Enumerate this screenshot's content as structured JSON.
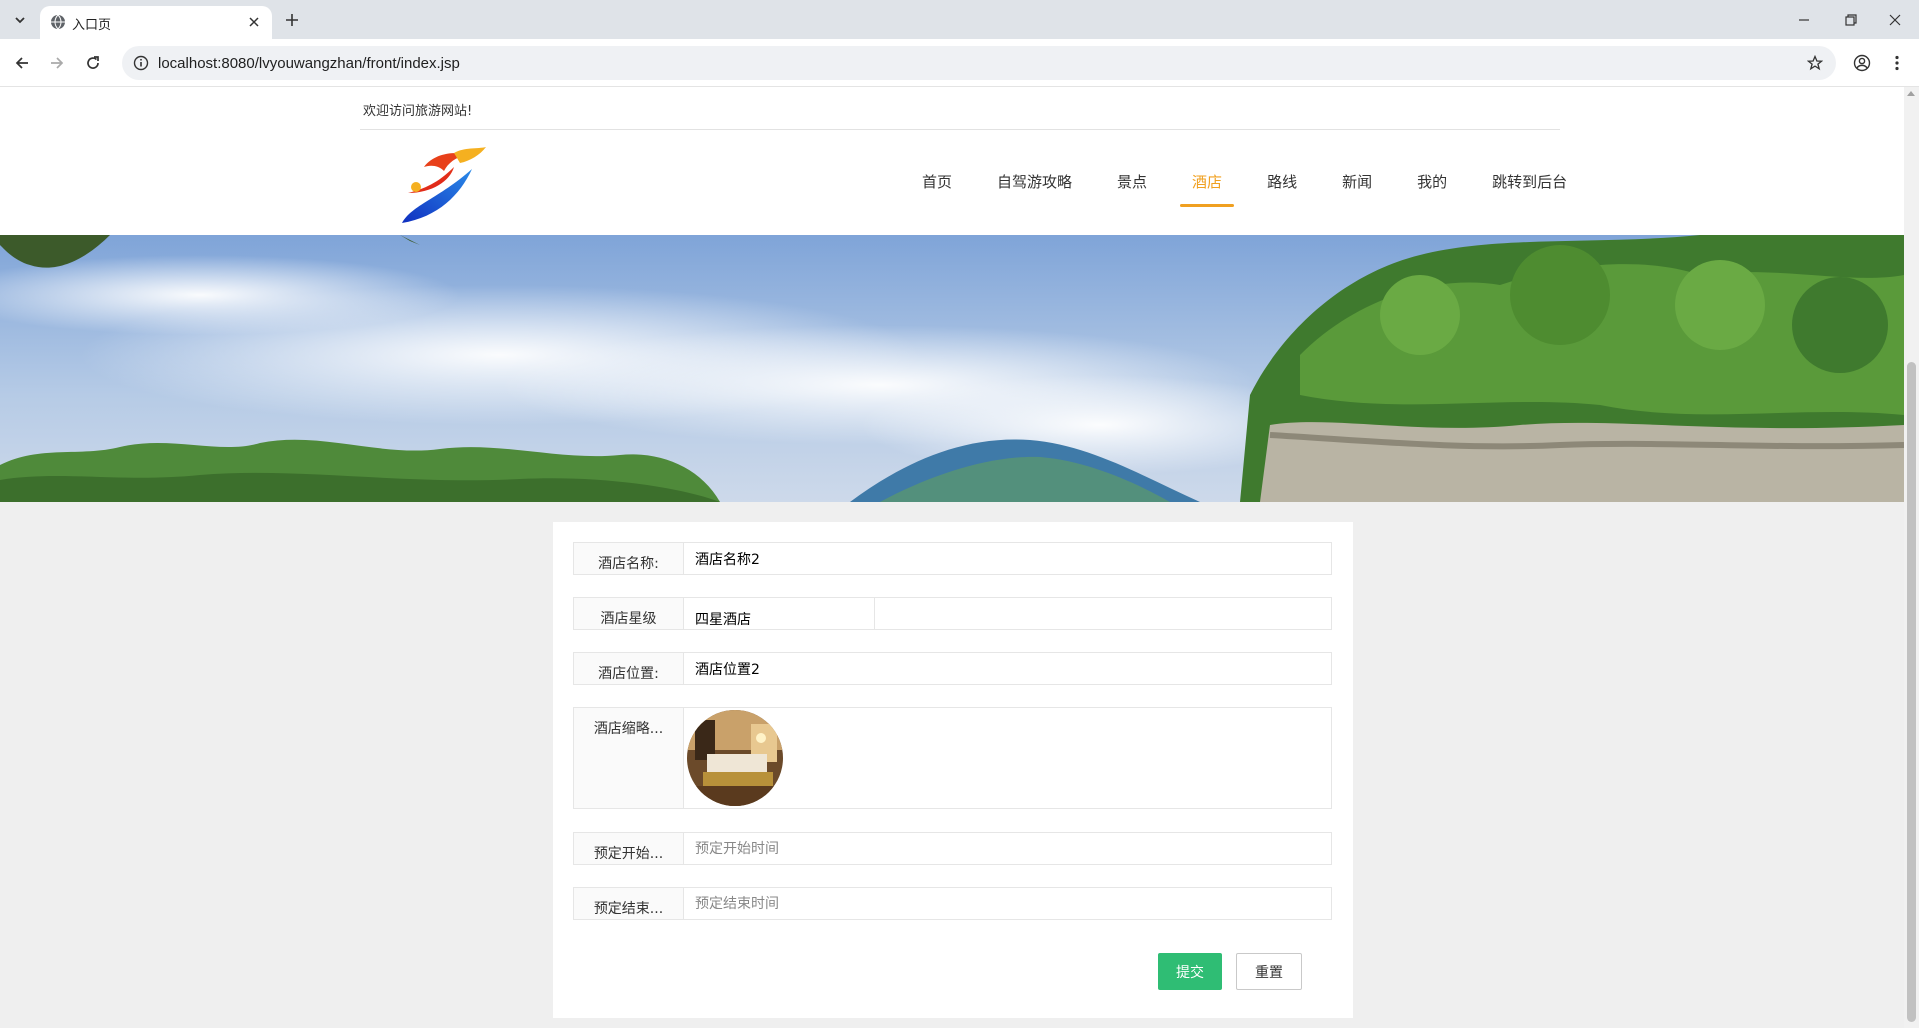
{
  "browser": {
    "tab_title": "入口页",
    "url": "localhost:8080/lvyouwangzhan/front/index.jsp"
  },
  "header": {
    "welcome": "欢迎访问旅游网站!",
    "nav": [
      {
        "label": "首页",
        "active": false
      },
      {
        "label": "自驾游攻略",
        "active": false
      },
      {
        "label": "景点",
        "active": false
      },
      {
        "label": "酒店",
        "active": true
      },
      {
        "label": "路线",
        "active": false
      },
      {
        "label": "新闻",
        "active": false
      },
      {
        "label": "我的",
        "active": false
      },
      {
        "label": "跳转到后台",
        "active": false
      }
    ],
    "accent_color": "#f0a020"
  },
  "form": {
    "hotel_name": {
      "label": "酒店名称:",
      "value": "酒店名称2"
    },
    "hotel_star": {
      "label": "酒店星级",
      "value": "四星酒店"
    },
    "hotel_location": {
      "label": "酒店位置:",
      "value": "酒店位置2"
    },
    "hotel_thumbnail": {
      "label": "酒店缩略..."
    },
    "start_time": {
      "label": "预定开始...",
      "placeholder": "预定开始时间",
      "value": ""
    },
    "end_time": {
      "label": "预定结束...",
      "placeholder": "预定结束时间",
      "value": ""
    },
    "submit_label": "提交",
    "reset_label": "重置",
    "submit_color": "#2fbd74"
  }
}
